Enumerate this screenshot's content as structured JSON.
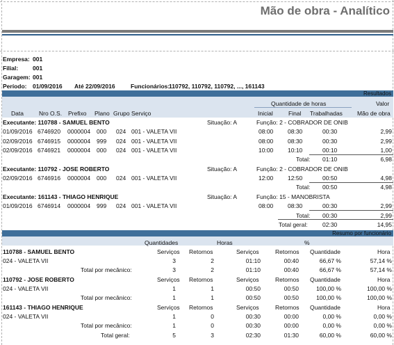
{
  "title": "Mão de obra - Analítico",
  "header": {
    "empresa_label": "Empresa:",
    "empresa": "001",
    "filial_label": "Filial:",
    "filial": "001",
    "garagem_label": "Garagem:",
    "garagem": "001",
    "periodo_label": "Período:",
    "periodo_ini": "01/09/2016",
    "ate_label": "Até",
    "periodo_fim": "22/09/2016",
    "funcionarios_label": "Funcionários:",
    "funcionarios": "110792, 110792, 110792, ..., 161143"
  },
  "resultados": {
    "band_label": "Resultados",
    "group_qh": "Quantidade de horas",
    "group_valor": "Valor",
    "cols": {
      "data": "Data",
      "nro_os": "Nro O.S.",
      "prefixo": "Prefixo",
      "plano": "Plano",
      "grupo": "Grupo",
      "servico": "Serviço",
      "inicial": "Inicial",
      "final": "Final",
      "trabalhadas": "Trabalhadas",
      "mao_de_obra": "Mão de obra"
    },
    "executantes": [
      {
        "label": "Executante: 110788 - SAMUEL BENTO",
        "situacao": "Situação: A",
        "funcao": "Função: 2 - COBRADOR DE ONIB",
        "rows": [
          {
            "data": "01/09/2016",
            "os": "6746920",
            "prefixo": "0000004",
            "plano": "000",
            "grupo": "024",
            "servico": "001 - VALETA VII",
            "inicial": "08:00",
            "final": "08:30",
            "trab": "00:30",
            "valor": "2,99"
          },
          {
            "data": "02/09/2016",
            "os": "6746915",
            "prefixo": "0000004",
            "plano": "999",
            "grupo": "024",
            "servico": "001 - VALETA VII",
            "inicial": "08:00",
            "final": "08:30",
            "trab": "00:30",
            "valor": "2,99"
          },
          {
            "data": "02/09/2016",
            "os": "6746921",
            "prefixo": "0000004",
            "plano": "000",
            "grupo": "024",
            "servico": "001 - VALETA VII",
            "inicial": "10:00",
            "final": "10:10",
            "trab": "00:10",
            "valor": "1,00"
          }
        ],
        "total_label": "Total:",
        "total_trab": "01:10",
        "total_valor": "6,98"
      },
      {
        "label": "Executante: 110792 - JOSE ROBERTO",
        "situacao": "Situação: A",
        "funcao": "Função: 2 - COBRADOR DE ONIB",
        "rows": [
          {
            "data": "02/09/2016",
            "os": "6746916",
            "prefixo": "0000004",
            "plano": "000",
            "grupo": "024",
            "servico": "001 - VALETA VII",
            "inicial": "12:00",
            "final": "12:50",
            "trab": "00:50",
            "valor": "4,98"
          }
        ],
        "total_label": "Total:",
        "total_trab": "00:50",
        "total_valor": "4,98"
      },
      {
        "label": "Executante: 161143 - THIAGO HENRIQUE",
        "situacao": "Situação: A",
        "funcao": "Função: 15 - MANOBRISTA",
        "rows": [
          {
            "data": "01/09/2016",
            "os": "6746914",
            "prefixo": "0000004",
            "plano": "999",
            "grupo": "024",
            "servico": "001 - VALETA VII",
            "inicial": "08:00",
            "final": "08:30",
            "trab": "00:30",
            "valor": "2,99"
          }
        ],
        "total_label": "Total:",
        "total_trab": "00:30",
        "total_valor": "2,99"
      }
    ],
    "total_geral_label": "Total geral:",
    "total_geral_trab": "02:30",
    "total_geral_valor": "14,95"
  },
  "resumo": {
    "band_label": "Resumo por funcionário",
    "group_qtd": "Quantidades",
    "group_horas": "Horas",
    "group_pct": "%",
    "col_servicos": "Serviços",
    "col_retornos": "Retornos",
    "col_quantidade": "Quantidade",
    "col_hora": "Hora",
    "total_mec_label": "Total por mecânico:",
    "funcionarios": [
      {
        "nome": "110788 - SAMUEL BENTO",
        "item": "024 - VALETA VII",
        "row": [
          "3",
          "2",
          "01:10",
          "00:40",
          "66,67 %",
          "57,14 %"
        ],
        "total": [
          "3",
          "2",
          "01:10",
          "00:40",
          "66,67 %",
          "57,14 %"
        ]
      },
      {
        "nome": "110792 - JOSE ROBERTO",
        "item": "024 - VALETA VII",
        "row": [
          "1",
          "1",
          "00:50",
          "00:50",
          "100,00 %",
          "100,00 %"
        ],
        "total": [
          "1",
          "1",
          "00:50",
          "00:50",
          "100,00 %",
          "100,00 %"
        ]
      },
      {
        "nome": "161143 - THIAGO HENRIQUE",
        "item": "024 - VALETA VII",
        "row": [
          "1",
          "0",
          "00:30",
          "00:00",
          "0,00 %",
          "0,00 %"
        ],
        "total": [
          "1",
          "0",
          "00:30",
          "00:00",
          "0,00 %",
          "0,00 %"
        ]
      }
    ],
    "total_geral_label": "Total geral:",
    "total_geral": [
      "5",
      "3",
      "02:30",
      "01:30",
      "60,00 %",
      "60,00 %"
    ]
  }
}
